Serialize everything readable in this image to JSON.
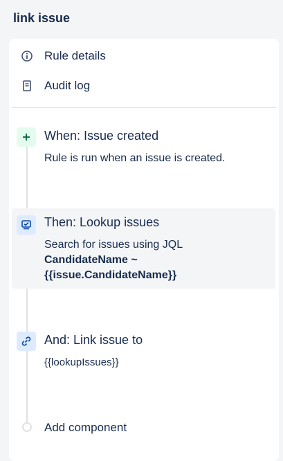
{
  "header": {
    "title": "link issue"
  },
  "menu": {
    "rule_details": "Rule details",
    "audit_log": "Audit log"
  },
  "steps": [
    {
      "title": "When: Issue created",
      "description": "Rule is run when an issue is created.",
      "icon": "plus-icon",
      "accent": "#e3fcef"
    },
    {
      "title": "Then: Lookup issues",
      "description": "Search for issues using JQL",
      "jql_line1": "CandidateName ~",
      "jql_line2": "{{issue.CandidateName}}",
      "icon": "lookup-icon",
      "accent": "#deebff"
    },
    {
      "title": "And: Link issue to",
      "description": "{{lookupIssues}}",
      "icon": "link-icon",
      "accent": "#deebff"
    }
  ],
  "add_component": "Add component"
}
